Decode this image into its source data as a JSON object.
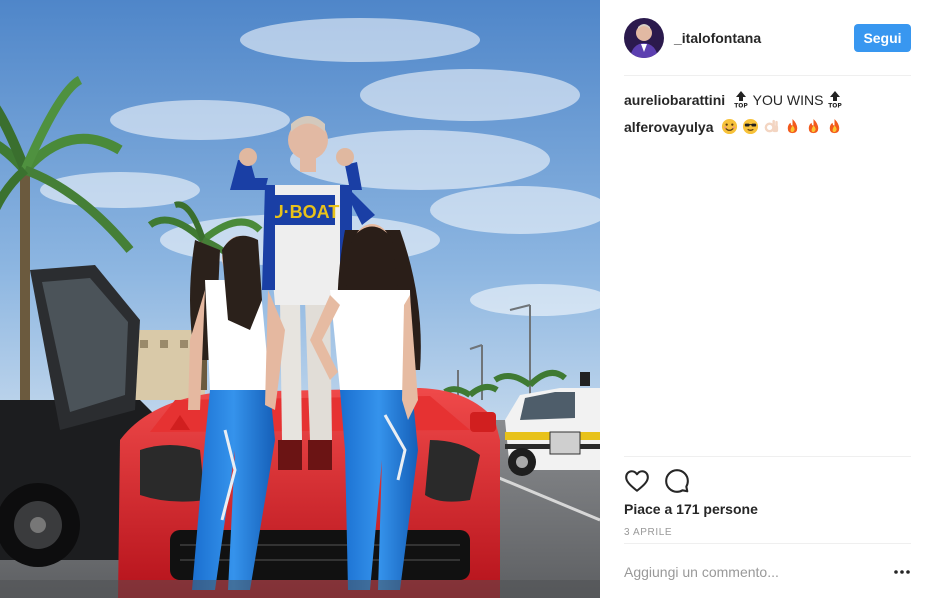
{
  "post": {
    "author": {
      "username": "_italofontana",
      "follow_label": "Segui"
    },
    "comments": [
      {
        "user": "aureliobarattini",
        "text": "YOU WINS",
        "emoji_before": "top-arrow",
        "emoji_after": "top-arrow"
      },
      {
        "user": "alferovayulya",
        "emojis": [
          "smiling-face",
          "sunglasses-face",
          "ok-hand",
          "fire",
          "fire",
          "fire"
        ]
      }
    ],
    "likes_text": "Piace a 171 persone",
    "date_text": "3 APRILE",
    "comment_placeholder": "Aggiungi un commento...",
    "icons": [
      "heart-icon",
      "comment-icon",
      "more-options-icon"
    ]
  },
  "colors": {
    "accent": "#3897f0",
    "text": "#262626",
    "muted": "#999999",
    "divider": "#efefef"
  }
}
